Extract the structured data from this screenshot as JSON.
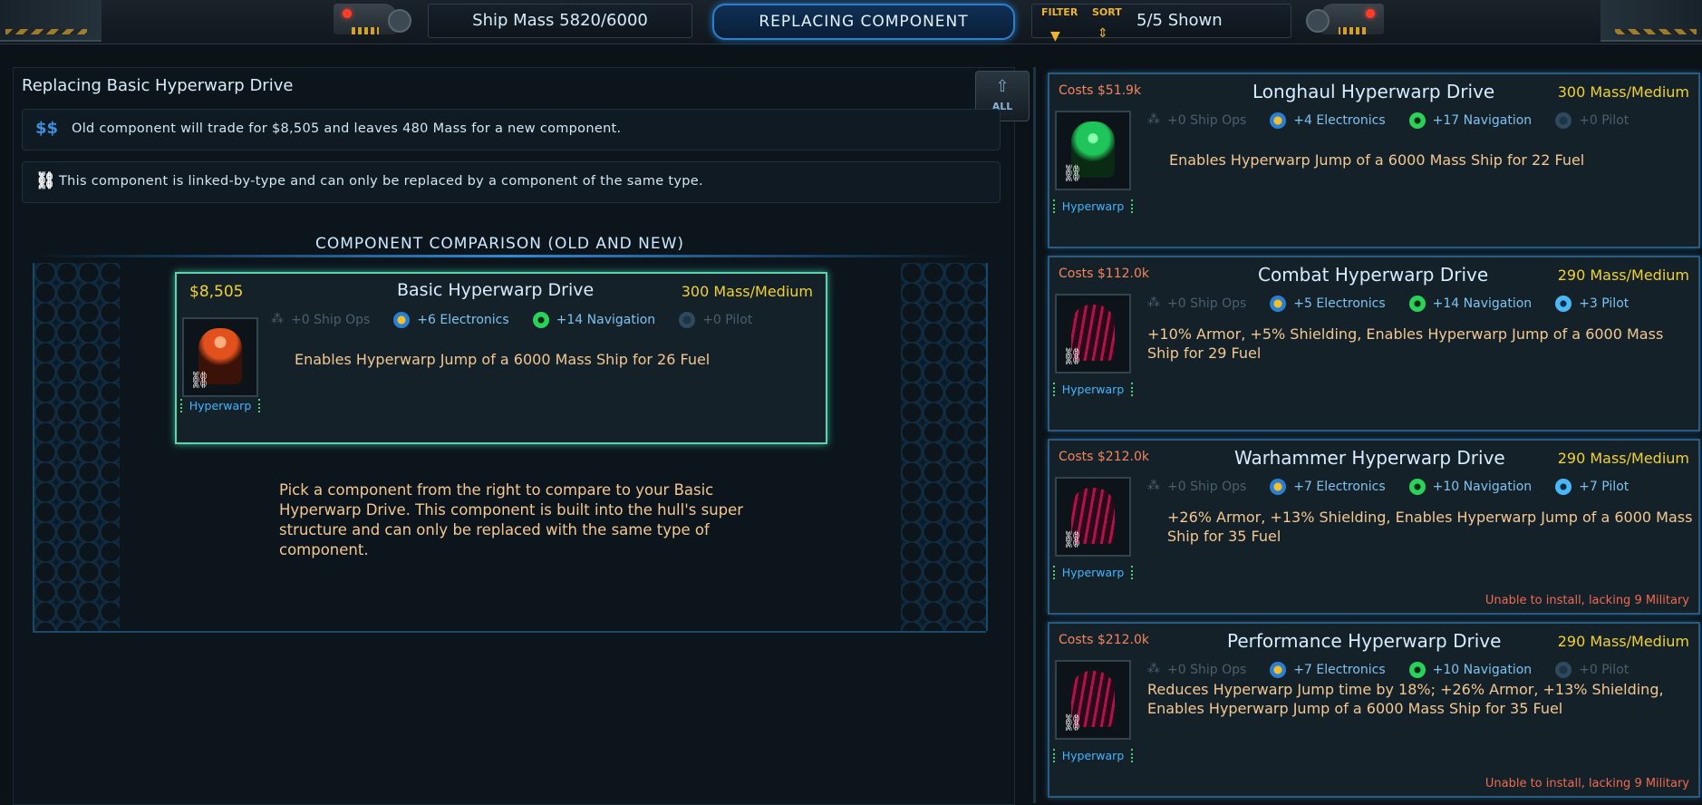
{
  "topbar": {
    "ship_mass": "Ship Mass 5820/6000",
    "mode": "REPLACING COMPONENT",
    "filter_label": "FILTER",
    "sort_label": "SORT",
    "shown": "5/5 Shown"
  },
  "left": {
    "title": "Replacing Basic Hyperwarp Drive",
    "all_button": "ALL",
    "info_trade_icon": "$$",
    "info_trade": "Old component will trade for $8,505 and leaves 480 Mass for a new component.",
    "info_link": "This component is linked-by-type and can only be replaced by a component of the same type.",
    "comparison_header": "COMPONENT COMPARISON (OLD AND NEW)",
    "help": "Pick a component from the right to compare to your Basic Hyperwarp Drive. This component is built into the hull's super structure and can only be replaced with the same type of component."
  },
  "old_component": {
    "price": "$8,505",
    "name": "Basic Hyperwarp Drive",
    "mass": "300 Mass/Medium",
    "ship_ops": "+0 Ship Ops",
    "electronics": "+6 Electronics",
    "navigation": "+14 Navigation",
    "pilot": "+0 Pilot",
    "description": "Enables Hyperwarp Jump of a 6000 Mass Ship for 26 Fuel",
    "type": "Hyperwarp"
  },
  "components": [
    {
      "costs_label": "Costs",
      "costs": "$51.9k",
      "name": "Longhaul Hyperwarp Drive",
      "mass": "300 Mass/Medium",
      "ship_ops": "+0 Ship Ops",
      "electronics": "+4 Electronics",
      "navigation": "+17 Navigation",
      "pilot": "+0 Pilot",
      "description": "Enables Hyperwarp Jump of a 6000 Mass Ship for 22 Fuel",
      "type": "Hyperwarp",
      "warning": ""
    },
    {
      "costs_label": "Costs",
      "costs": "$112.0k",
      "name": "Combat Hyperwarp Drive",
      "mass": "290 Mass/Medium",
      "ship_ops": "+0 Ship Ops",
      "electronics": "+5 Electronics",
      "navigation": "+14 Navigation",
      "pilot": "+3 Pilot",
      "description": "+10% Armor, +5% Shielding, Enables Hyperwarp Jump of a 6000 Mass Ship for 29 Fuel",
      "type": "Hyperwarp",
      "warning": ""
    },
    {
      "costs_label": "Costs",
      "costs": "$212.0k",
      "name": "Warhammer Hyperwarp Drive",
      "mass": "290 Mass/Medium",
      "ship_ops": "+0 Ship Ops",
      "electronics": "+7 Electronics",
      "navigation": "+10 Navigation",
      "pilot": "+7 Pilot",
      "description": "+26% Armor, +13% Shielding, Enables Hyperwarp Jump of a 6000 Mass Ship for 35 Fuel",
      "type": "Hyperwarp",
      "warning": "Unable to install, lacking 9 Military"
    },
    {
      "costs_label": "Costs",
      "costs": "$212.0k",
      "name": "Performance Hyperwarp Drive",
      "mass": "290 Mass/Medium",
      "ship_ops": "+0 Ship Ops",
      "electronics": "+7 Electronics",
      "navigation": "+10 Navigation",
      "pilot": "+0 Pilot",
      "description": "Reduces Hyperwarp Jump time by 18%; +26% Armor, +13% Shielding, Enables Hyperwarp Jump of a 6000 Mass Ship for 35 Fuel",
      "type": "Hyperwarp",
      "warning": "Unable to install, lacking 9 Military"
    }
  ],
  "colors": {
    "accent": "#2d7fc9",
    "price": "#f1d22d",
    "cost": "#f28560",
    "warning": "#f06a52",
    "description": "#f2c792"
  }
}
